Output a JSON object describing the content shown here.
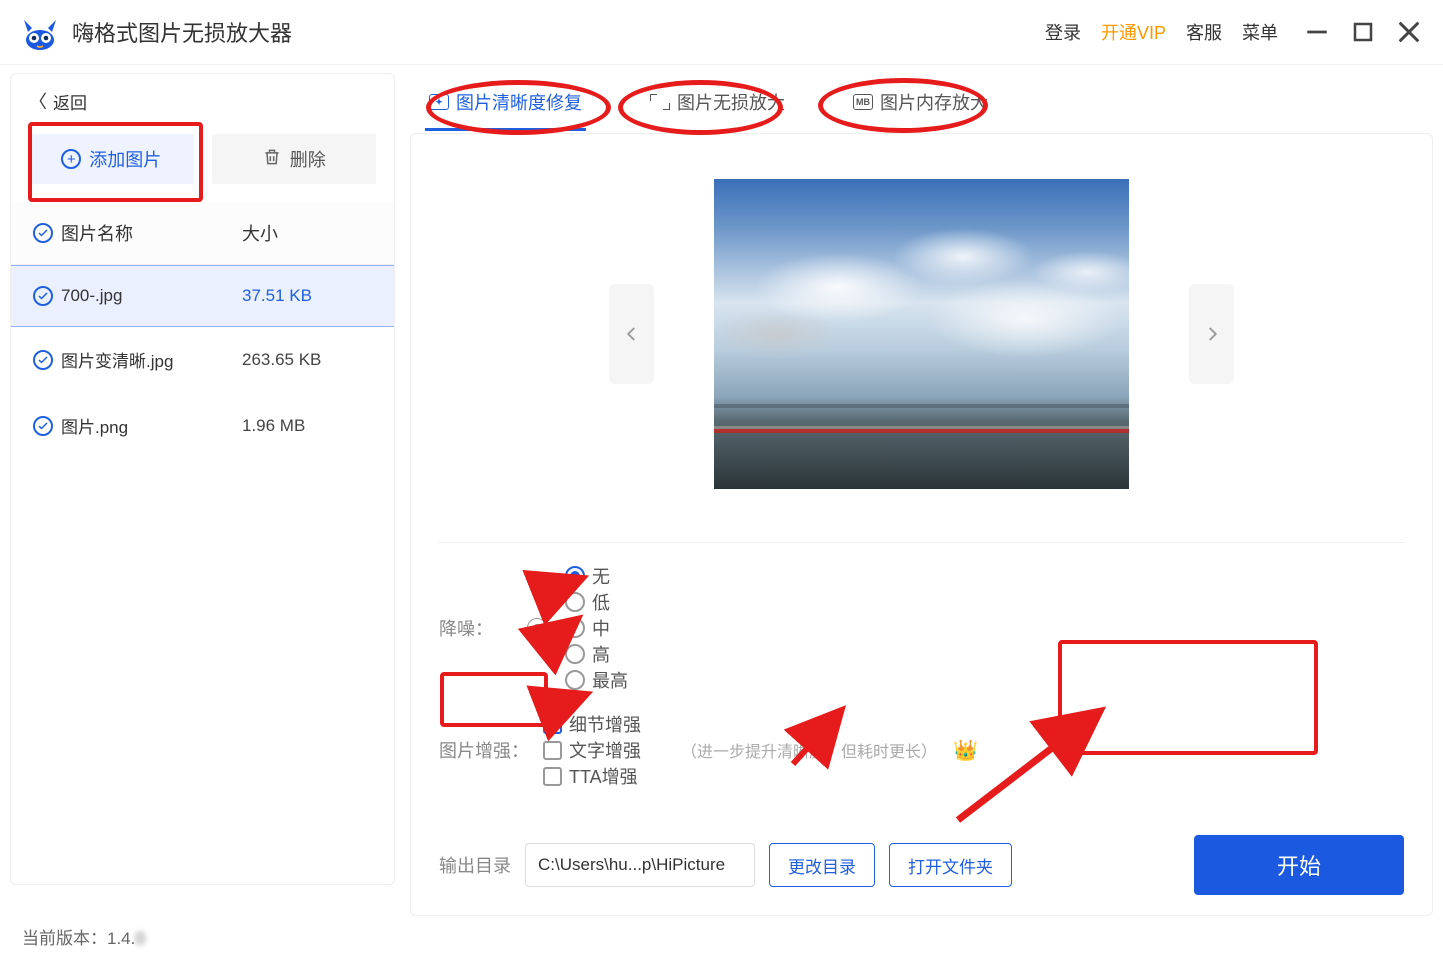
{
  "header": {
    "title": "嗨格式图片无损放大器",
    "login": "登录",
    "vip": "开通VIP",
    "support": "客服",
    "menu": "菜单"
  },
  "sidebar": {
    "back": "返回",
    "add_btn": "添加图片",
    "del_btn": "删除",
    "col_name": "图片名称",
    "col_size": "大小",
    "files": [
      {
        "name": "700-.jpg",
        "size": "37.51 KB",
        "selected": true
      },
      {
        "name": "图片变清晰.jpg",
        "size": "263.65 KB",
        "selected": false
      },
      {
        "name": "图片.png",
        "size": "1.96 MB",
        "selected": false
      }
    ]
  },
  "tabs": [
    {
      "label": "图片清晰度修复",
      "active": true
    },
    {
      "label": "图片无损放大",
      "active": false
    },
    {
      "label": "图片内存放大",
      "active": false
    }
  ],
  "denoise": {
    "label": "降噪：",
    "options": [
      "无",
      "低",
      "中",
      "高",
      "最高"
    ],
    "selected": "无"
  },
  "enhance": {
    "label": "图片增强：",
    "options": [
      {
        "label": "细节增强",
        "checked": true
      },
      {
        "label": "文字增强",
        "checked": false
      },
      {
        "label": "TTA增强",
        "checked": false
      }
    ],
    "hint": "（进一步提升清晰度，但耗时更长）"
  },
  "output": {
    "label": "输出目录",
    "path": "C:\\Users\\hu...p\\HiPicture",
    "change_btn": "更改目录",
    "open_btn": "打开文件夹",
    "start_btn": "开始"
  },
  "footer": {
    "version_label": "当前版本：",
    "version": "1.4.",
    "version_tail": "0"
  }
}
